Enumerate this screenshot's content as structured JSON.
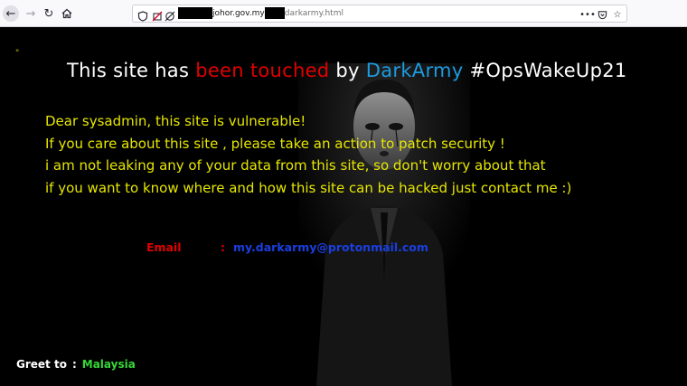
{
  "browser": {
    "url_domain": "johor.gov.my",
    "url_path": "darkarmy.html",
    "icons": [
      "back-arrow-icon",
      "forward-arrow-icon",
      "reload-icon",
      "home-icon",
      "shield-icon",
      "no-tracking-icon",
      "permissions-icon",
      "more-options-icon",
      "pocket-icon",
      "bookmark-star-icon"
    ]
  },
  "page": {
    "quote_mark": "\"",
    "headline": {
      "part1": "This site has ",
      "part2": "been touched",
      "part3": " by ",
      "part4": "DarkArmy",
      "part5": " #OpsWakeUp21"
    },
    "message_lines": [
      "Dear sysadmin, this site is vulnerable!",
      "If you care about this site , please take an action to patch security !",
      "i am not leaking any of your data from this site, so don't worry about that",
      "if you want to know where and how this site can be hacked just contact me :)"
    ],
    "contact": {
      "label": "Email",
      "separator": ":",
      "value": "my.darkarmy@protonmail.com"
    },
    "greet": {
      "label": "Greet to",
      "separator": ":",
      "value": "Malaysia"
    }
  },
  "colors": {
    "background": "#000000",
    "headline_white": "#ffffff",
    "headline_red": "#e00000",
    "headline_blue": "#1c9be0",
    "message_yellow": "#e6e600",
    "email_blue": "#1a3fe0",
    "greet_green": "#37d637"
  }
}
